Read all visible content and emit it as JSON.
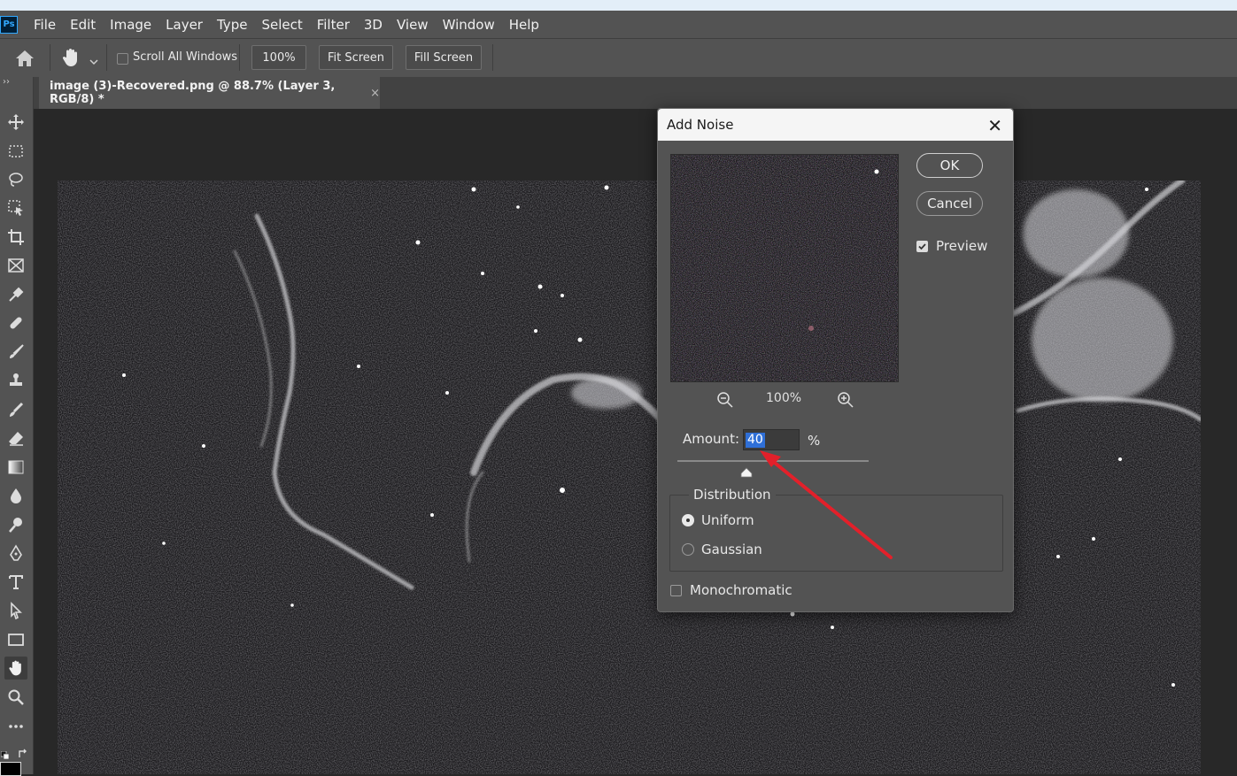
{
  "app": {
    "logo": "Ps"
  },
  "menu": [
    "File",
    "Edit",
    "Image",
    "Layer",
    "Type",
    "Select",
    "Filter",
    "3D",
    "View",
    "Window",
    "Help"
  ],
  "options": {
    "scroll_all_windows": "Scroll All Windows",
    "zoom_100": "100%",
    "fit_screen": "Fit Screen",
    "fill_screen": "Fill Screen"
  },
  "document_tab": {
    "title": "image (3)-Recovered.png @ 88.7% (Layer 3, RGB/8) *",
    "close": "×"
  },
  "dialog": {
    "title": "Add Noise",
    "close": "✕",
    "ok": "OK",
    "cancel": "Cancel",
    "preview_label": "Preview",
    "preview_checked": true,
    "zoom_level": "100%",
    "amount_label": "Amount:",
    "amount_value": "40",
    "amount_unit": "%",
    "amount_slider_fraction": 0.36,
    "distribution_label": "Distribution",
    "distribution_options": [
      "Uniform",
      "Gaussian"
    ],
    "distribution_selected": "Uniform",
    "monochromatic_label": "Monochromatic",
    "monochromatic_checked": false
  },
  "colors": {
    "panel": "#535353",
    "workspace": "#282828",
    "selection": "#2f6fd6",
    "arrow": "#e3202a"
  }
}
